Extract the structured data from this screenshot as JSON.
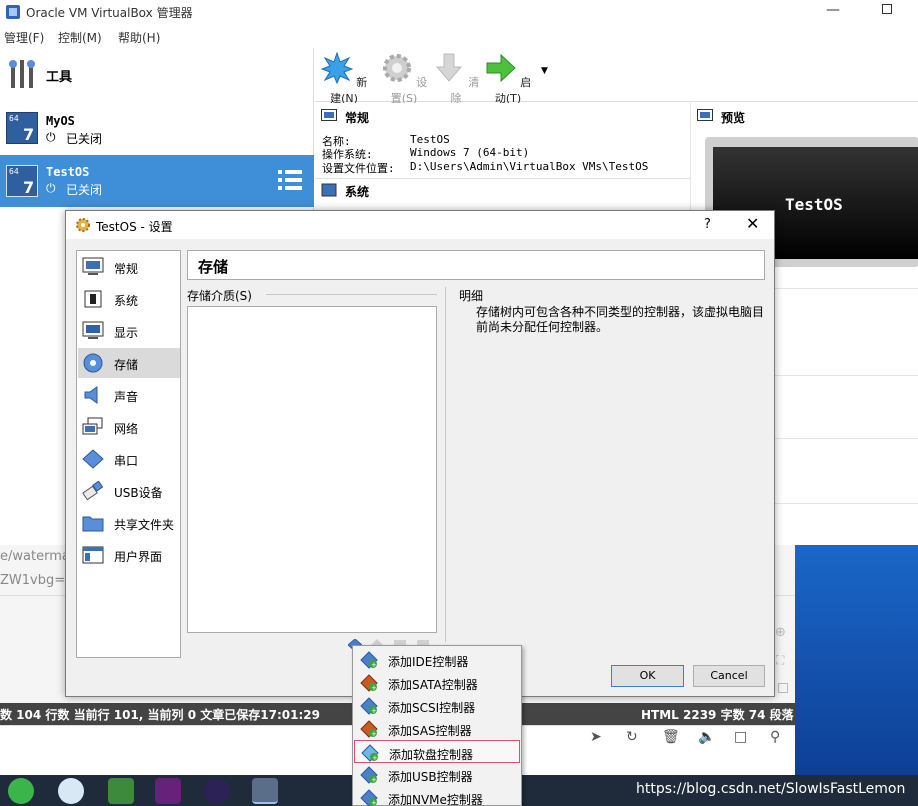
{
  "window": {
    "title": "Oracle VM VirtualBox 管理器"
  },
  "menu": [
    "管理(F)",
    "控制(M)",
    "帮助(H)"
  ],
  "tools": {
    "label": "工具"
  },
  "vms": [
    {
      "name": "MyOS",
      "state": "已关闭",
      "badge": "7",
      "bits": "64"
    },
    {
      "name": "TestOS",
      "state": "已关闭",
      "badge": "7",
      "bits": "64"
    }
  ],
  "toolbar": {
    "new": "新建(N)",
    "settings": "设置(S)",
    "discard": "清除",
    "start": "启动(T)"
  },
  "details": {
    "general_title": "常规",
    "rows": [
      {
        "k": "名称:",
        "v": "TestOS"
      },
      {
        "k": "操作系统:",
        "v": "Windows 7 (64-bit)"
      },
      {
        "k": "设置文件位置:",
        "v": "D:\\Users\\Admin\\VirtualBox VMs\\TestOS"
      }
    ],
    "system_title": "系统"
  },
  "preview": {
    "title": "预览",
    "vm_name": "TestOS"
  },
  "dialog": {
    "title": "TestOS - 设置",
    "help": "?",
    "nav": [
      "常规",
      "系统",
      "显示",
      "存储",
      "声音",
      "网络",
      "串口",
      "USB设备",
      "共享文件夹",
      "用户界面"
    ],
    "header": "存储",
    "storage_label": "存储介质(S)",
    "info_label": "明细",
    "info_text": "存储树内可包含各种不同类型的控制器，该虚拟电脑目前尚未分配任何控制器。",
    "ok": "OK",
    "cancel": "Cancel"
  },
  "popup_menu": [
    "添加IDE控制器",
    "添加SATA控制器",
    "添加SCSI控制器",
    "添加SAS控制器",
    "添加软盘控制器",
    "添加USB控制器",
    "添加NVMe控制器"
  ],
  "editor": {
    "bg_text_1": "e/waterma",
    "bg_text_2": "ZW1vbg==",
    "status_left": "数  104 行数  当前行 101, 当前列 0  文章已保存17:01:29",
    "status_right": "HTML  2239 字数  74 段落"
  },
  "watermark": "https://blog.csdn.net/SlowIsFastLemon",
  "colors": {
    "selection": "#3f8fd8",
    "highlight_border": "#e0506a",
    "accent_green": "#3aa53a"
  }
}
